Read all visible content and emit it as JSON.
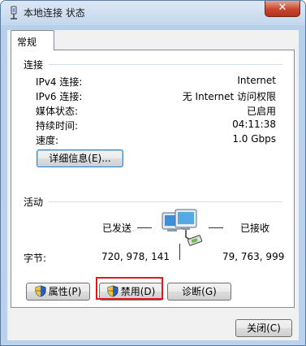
{
  "window": {
    "title": "本地连接 状态",
    "close": "✕"
  },
  "tab": {
    "label": "常规"
  },
  "connection": {
    "heading": "连接",
    "rows": [
      {
        "label": "IPv4 连接:",
        "value": "Internet"
      },
      {
        "label": "IPv6 连接:",
        "value": "无 Internet 访问权限"
      },
      {
        "label": "媒体状态:",
        "value": "已启用"
      },
      {
        "label": "持续时间:",
        "value": "04:11:38"
      },
      {
        "label": "速度:",
        "value": "1.0 Gbps"
      }
    ],
    "details_button": "详细信息(E)..."
  },
  "activity": {
    "heading": "活动",
    "sent_label": "已发送",
    "received_label": "已接收",
    "bytes_label": "字节:",
    "bytes_sent": "720, 978, 141",
    "bytes_received": "79, 763, 999"
  },
  "buttons": {
    "properties": "属性(P)",
    "disable": "禁用(D)",
    "diagnose": "诊断(G)",
    "close": "关闭(C)"
  },
  "colors": {
    "highlight": "#e0191e",
    "titlebar": "#c4d7ee",
    "close_button": "#c7472e"
  }
}
